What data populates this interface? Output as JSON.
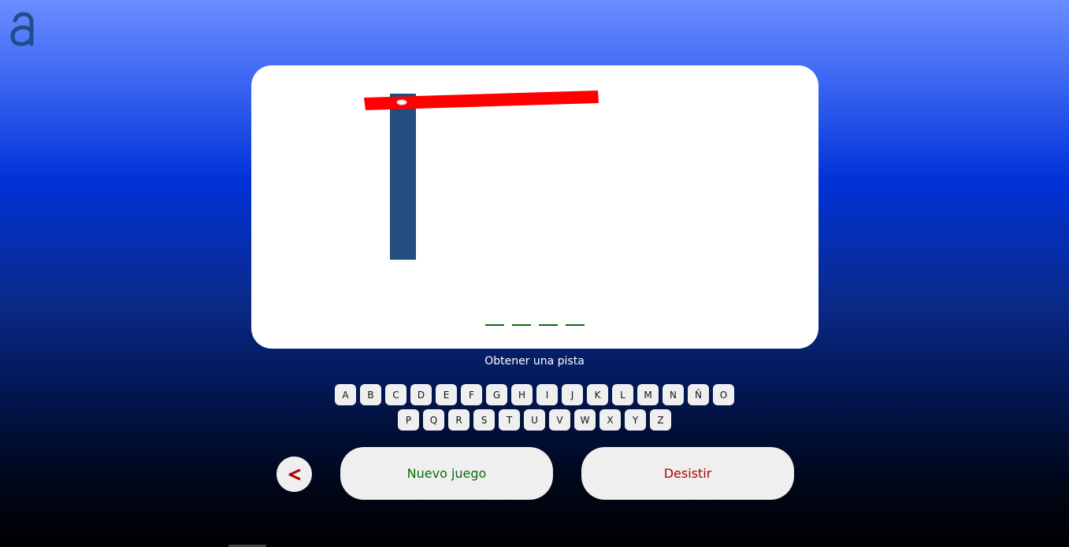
{
  "app": {
    "logo_icon": "accessibility-a-logo",
    "logo_color": "#1f4e8c"
  },
  "game": {
    "word_slots": 4,
    "slot_color": "#0a6a0a",
    "gallows": {
      "post_color": "#224d80",
      "beam_color": "#ff0000"
    }
  },
  "hint": {
    "label": "Obtener una pista"
  },
  "keyboard": {
    "row1": [
      "A",
      "B",
      "C",
      "D",
      "E",
      "F",
      "G",
      "H",
      "I",
      "J",
      "K",
      "L",
      "M",
      "N",
      "Ñ",
      "O"
    ],
    "row2": [
      "P",
      "Q",
      "R",
      "S",
      "T",
      "U",
      "V",
      "W",
      "X",
      "Y",
      "Z"
    ]
  },
  "controls": {
    "back_icon": "chevron-left-icon",
    "new_game_label": "Nuevo juego",
    "give_up_label": "Desistir",
    "new_game_color": "#0a6a0a",
    "give_up_color": "#b00000"
  }
}
